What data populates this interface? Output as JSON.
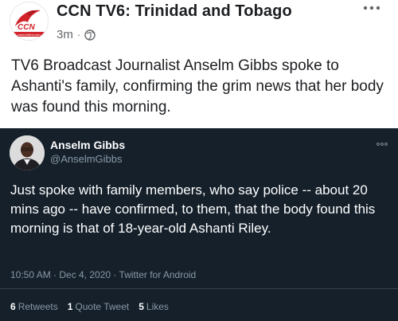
{
  "post": {
    "page_name": "CCN TV6: Trinidad and Tobago",
    "time_ago": "3m",
    "separator": "·",
    "privacy_icon": "globe-icon",
    "more_icon": "more-horizontal-icon",
    "text": "TV6 Broadcast Journalist Anselm Gibbs spoke to Ashanti's family, confirming the grim news that her body was found this morning.",
    "avatar": {
      "logo_text": "CCN",
      "site_text": "www.tv6tnt.com"
    }
  },
  "tweet": {
    "display_name": "Anselm Gibbs",
    "handle": "@AnselmGibbs",
    "more_icon": "more-horizontal-icon",
    "text": "Just spoke with family members, who say police -- about 20 mins ago -- have confirmed, to them, that the body found this morning is that of 18-year-old Ashanti Riley.",
    "timestamp": "10:50 AM · Dec 4, 2020 · Twitter for Android",
    "stats": {
      "retweets_count": "6",
      "retweets_label": "Retweets",
      "quotes_count": "1",
      "quotes_label": "Quote Tweet",
      "likes_count": "5",
      "likes_label": "Likes"
    }
  },
  "colors": {
    "fb_text": "#1c1e21",
    "fb_meta": "#65676b",
    "tweet_bg": "#15202b",
    "tweet_secondary": "#8899a6",
    "logo_red": "#d2232a"
  }
}
